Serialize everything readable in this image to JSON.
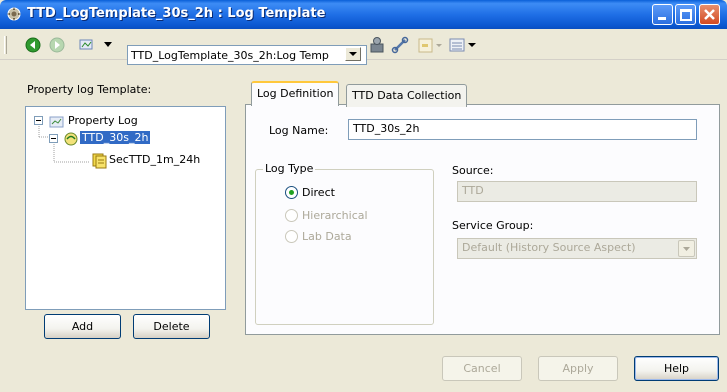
{
  "window": {
    "title": "TTD_LogTemplate_30s_2h : Log Template",
    "controls": {
      "minimize": "minimize",
      "maximize": "maximize",
      "close": "close"
    }
  },
  "toolbar": {
    "address_value": "TTD_LogTemplate_30s_2h:Log Temp",
    "icons": [
      "back-arrow-icon",
      "forward-arrow-icon",
      "object-icon",
      "dropdown-icon",
      "users-icon",
      "link-icon",
      "placeholder-icon",
      "list-icon"
    ]
  },
  "left_panel": {
    "label": "Property log Template:",
    "tree": [
      {
        "label": "Property Log",
        "level": 0
      },
      {
        "label": "TTD_30s_2h",
        "level": 1,
        "selected": true
      },
      {
        "label": "SecTTD_1m_24h",
        "level": 2
      }
    ],
    "add_label": "Add",
    "delete_label": "Delete"
  },
  "tabs": [
    {
      "label": "Log Definition",
      "active": true
    },
    {
      "label": "TTD Data Collection",
      "active": false
    }
  ],
  "log_definition": {
    "log_name_label": "Log Name:",
    "log_name_value": "TTD_30s_2h",
    "log_type_title": "Log Type",
    "log_types": [
      {
        "label": "Direct",
        "checked": true,
        "enabled": true
      },
      {
        "label": "Hierarchical",
        "checked": false,
        "enabled": false
      },
      {
        "label": "Lab Data",
        "checked": false,
        "enabled": false
      }
    ],
    "source_label": "Source:",
    "source_value": "TTD",
    "service_group_label": "Service Group:",
    "service_group_value": "Default (History Source Aspect)"
  },
  "footer": {
    "cancel_label": "Cancel",
    "apply_label": "Apply",
    "help_label": "Help"
  },
  "colors": {
    "title_bar": "#0b57d0",
    "window_bg": "#ece9d8",
    "selection": "#316ac5",
    "tab_highlight": "#ffc83c"
  }
}
